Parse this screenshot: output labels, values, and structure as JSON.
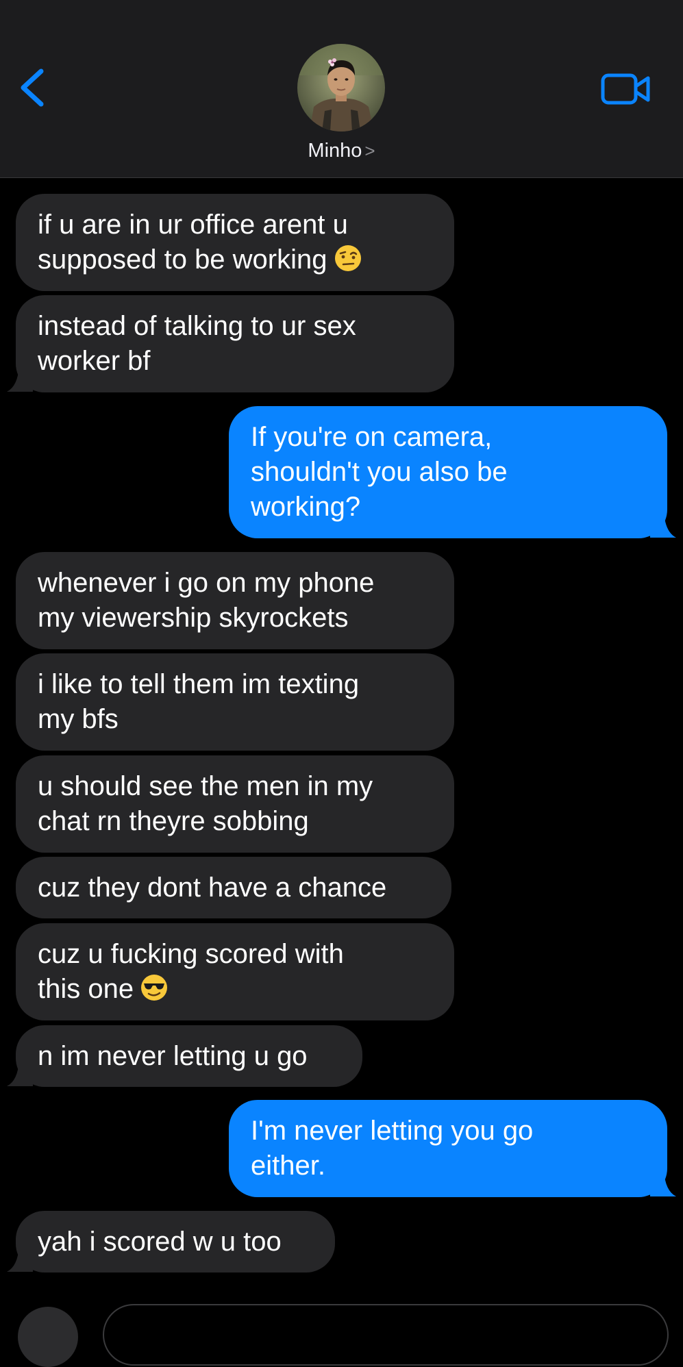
{
  "header": {
    "contact_name": "Minho",
    "chevron": ">",
    "back_icon": "chevron-left-icon",
    "video_icon": "video-camera-icon",
    "accent_color": "#0a84ff"
  },
  "messages": [
    {
      "from": "them",
      "text": "if u are in ur office arent u\nsupposed to be working",
      "emoji": "raised-eyebrow-emoji"
    },
    {
      "from": "them",
      "text": "instead of talking to ur sex\nworker bf"
    },
    {
      "from": "me",
      "text": "If you're on camera,\nshouldn't you also be\nworking?"
    },
    {
      "from": "them",
      "text": "whenever i go on my phone\nmy viewership skyrockets"
    },
    {
      "from": "them",
      "text": "i like to tell them im texting\nmy bfs"
    },
    {
      "from": "them",
      "text": "u should see the men in my\nchat rn theyre sobbing"
    },
    {
      "from": "them",
      "text": "cuz they dont have a chance"
    },
    {
      "from": "them",
      "text": "cuz u fucking scored with\nthis one",
      "emoji": "sunglasses-emoji"
    },
    {
      "from": "them",
      "text": "n im never letting u go"
    },
    {
      "from": "me",
      "text": "I'm never letting you go\neither."
    },
    {
      "from": "them",
      "text": "yah i scored w u too"
    }
  ],
  "colors": {
    "incoming_bubble": "#262628",
    "outgoing_bubble": "#0a84ff",
    "background": "#000000",
    "header_background": "#1c1c1e"
  }
}
